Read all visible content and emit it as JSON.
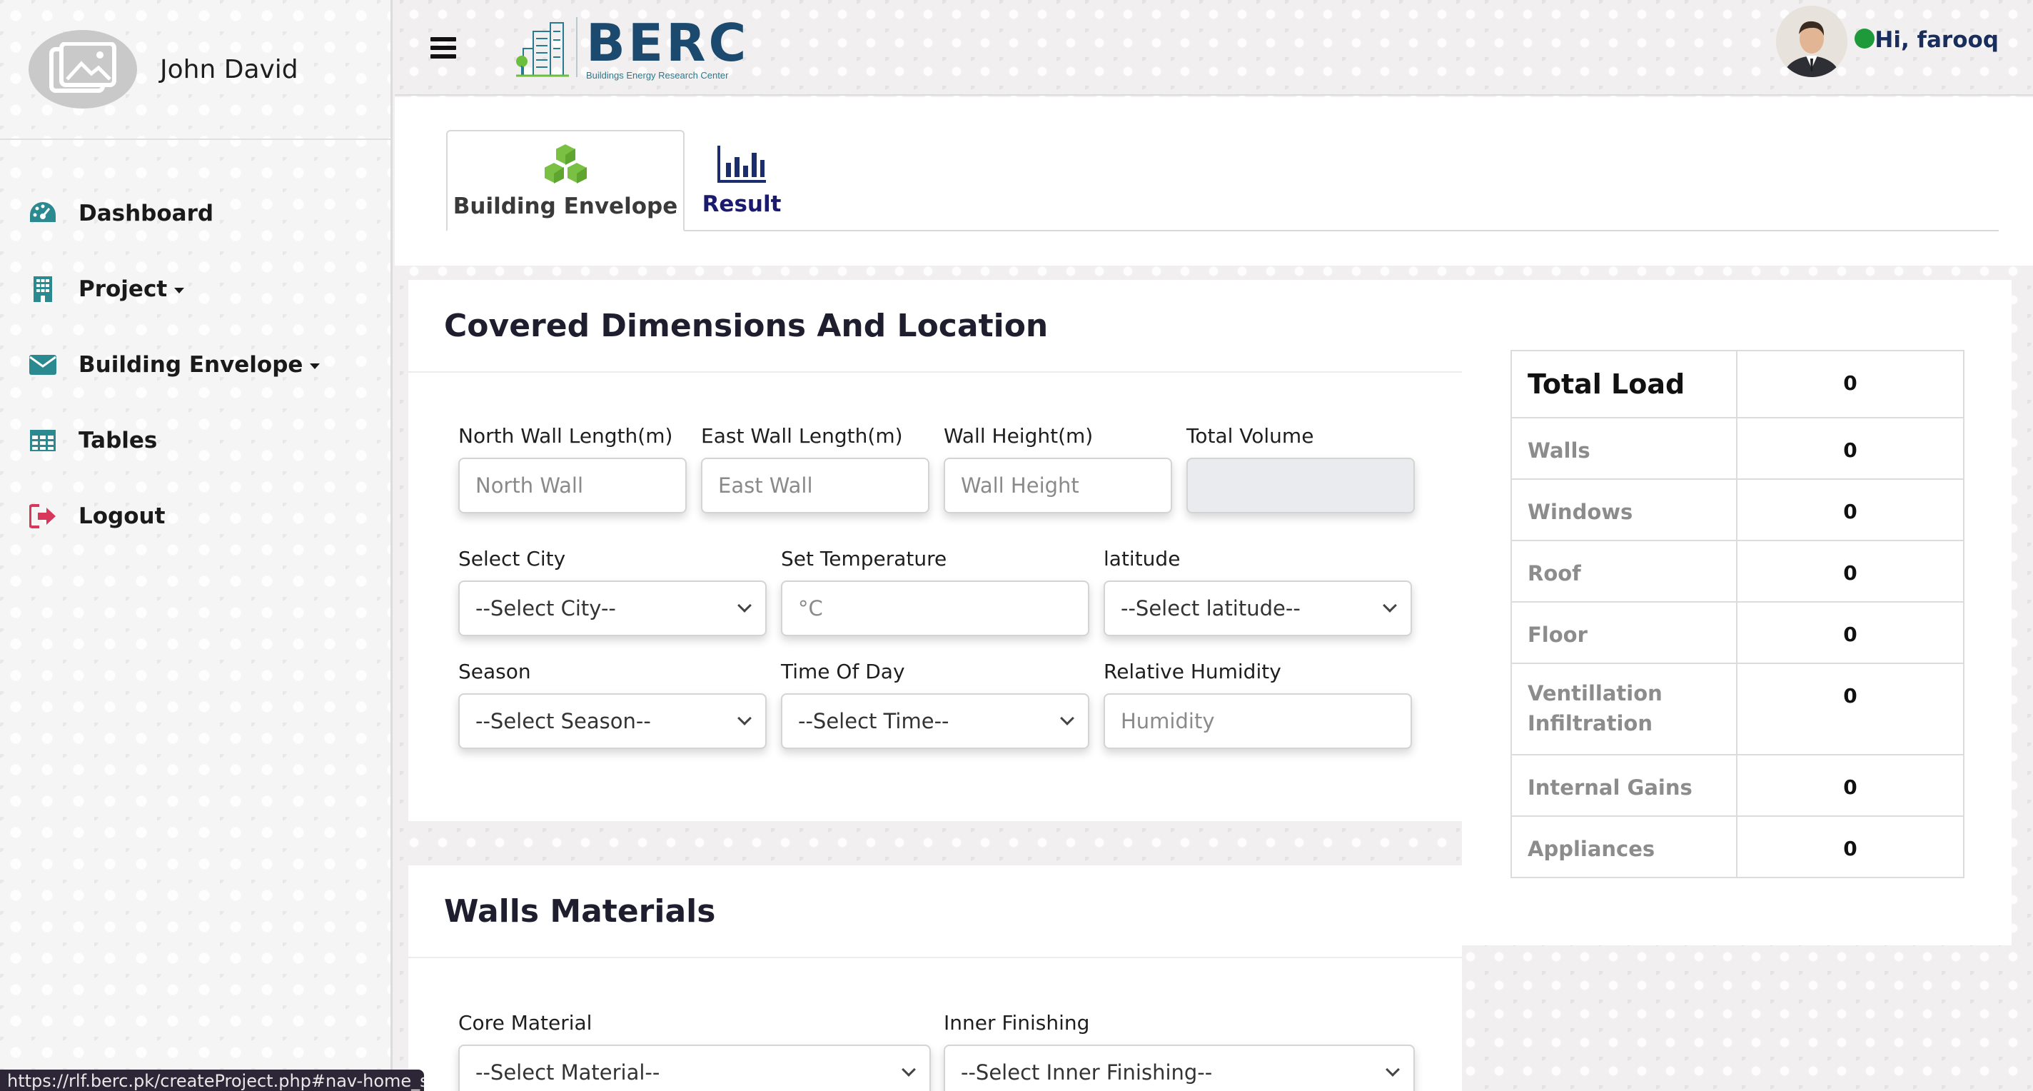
{
  "sidebar": {
    "user_name": "John David",
    "items": [
      {
        "label": "Dashboard",
        "icon": "tachometer-icon"
      },
      {
        "label": "Project",
        "icon": "building-icon"
      },
      {
        "label": "Building Envelope",
        "icon": "envelope-icon"
      },
      {
        "label": "Tables",
        "icon": "table-icon"
      },
      {
        "label": "Logout",
        "icon": "sign-out-icon"
      }
    ]
  },
  "header": {
    "logo_text": "BERC",
    "logo_subtitle": "Buildings Energy Research Center",
    "greeting": "Hi, farooq"
  },
  "tabs": [
    {
      "label": "Building Envelope",
      "icon": "cubes-icon",
      "active": true
    },
    {
      "label": "Result",
      "icon": "bar-chart-icon",
      "active": false
    }
  ],
  "section1": {
    "title": "Covered Dimensions And Location",
    "north_wall": {
      "label": "North Wall Length(m)",
      "placeholder": "North Wall"
    },
    "east_wall": {
      "label": "East Wall Length(m)",
      "placeholder": "East Wall"
    },
    "wall_height": {
      "label": "Wall Height(m)",
      "placeholder": "Wall Height"
    },
    "total_volume": {
      "label": "Total Volume",
      "value": ""
    },
    "city": {
      "label": "Select City",
      "selected": "--Select City--"
    },
    "temperature": {
      "label": "Set Temperature",
      "placeholder": "°C"
    },
    "latitude": {
      "label": "latitude",
      "selected": "--Select latitude--"
    },
    "season": {
      "label": "Season",
      "selected": "--Select Season--"
    },
    "time_of_day": {
      "label": "Time Of Day",
      "selected": "--Select Time--"
    },
    "humidity": {
      "label": "Relative Humidity",
      "placeholder": "Humidity"
    }
  },
  "section2": {
    "title": "Walls Materials",
    "core_material": {
      "label": "Core Material",
      "selected": "--Select Material--"
    },
    "inner_finishing": {
      "label": "Inner Finishing",
      "selected": "--Select Inner Finishing--"
    }
  },
  "results": {
    "total_label": "Total Load",
    "total_value": "0",
    "rows": [
      {
        "label": "Walls",
        "value": "0"
      },
      {
        "label": "Windows",
        "value": "0"
      },
      {
        "label": "Roof",
        "value": "0"
      },
      {
        "label": "Floor",
        "value": "0"
      },
      {
        "label": "Ventillation Infiltration",
        "value": "0"
      },
      {
        "label": "Internal Gains",
        "value": "0"
      },
      {
        "label": "Appliances",
        "value": "0"
      }
    ]
  },
  "status_bar_url": "https://rlf.berc.pk/createProject.php#nav-home_s2",
  "colors": {
    "accent_green": "#1e9a3a",
    "icon_teal": "#2a8a8f",
    "logout_red": "#d8365a",
    "navy": "#1a2e5e"
  }
}
